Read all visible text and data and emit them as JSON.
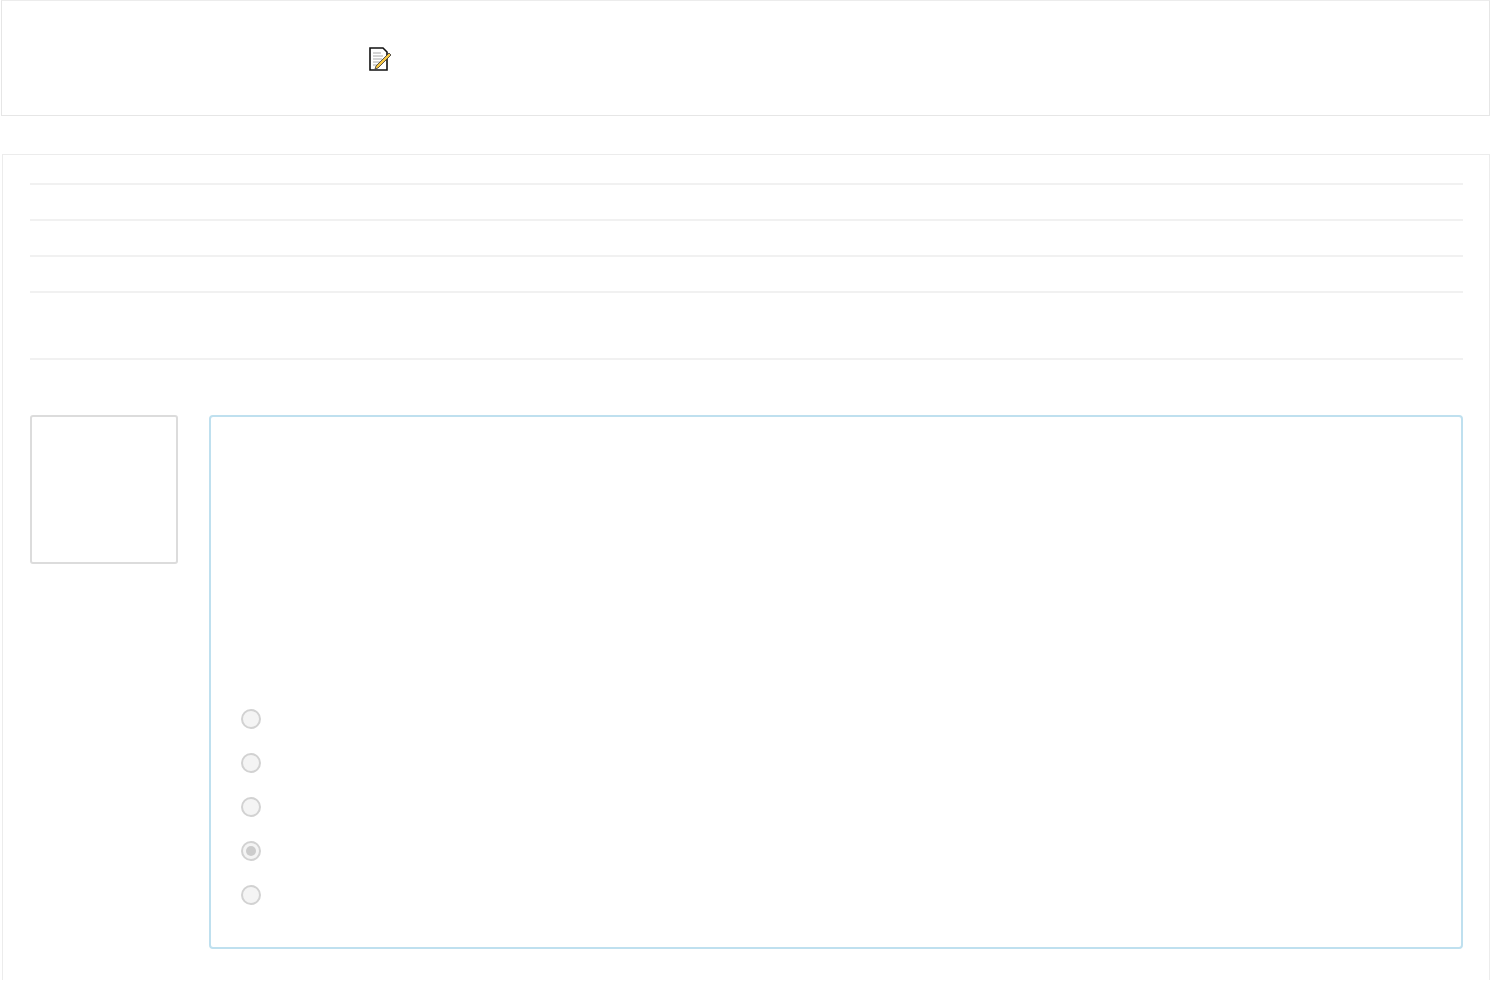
{
  "question": {
    "options": [
      {
        "selected": false
      },
      {
        "selected": false
      },
      {
        "selected": false
      },
      {
        "selected": true
      },
      {
        "selected": false
      }
    ]
  }
}
